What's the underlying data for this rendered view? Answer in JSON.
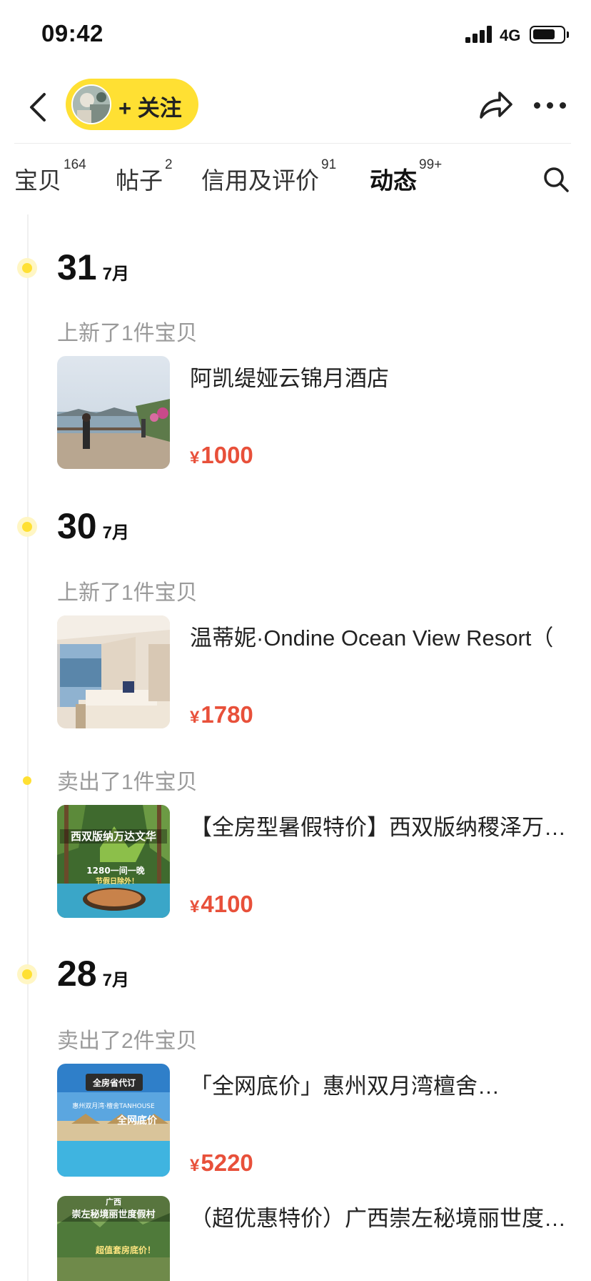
{
  "status_bar": {
    "time": "09:42",
    "network": "4G"
  },
  "header": {
    "follow_label": "+ 关注"
  },
  "tabs": [
    {
      "label": "宝贝",
      "count": "164"
    },
    {
      "label": "帖子",
      "count": "2"
    },
    {
      "label": "信用及评价",
      "count": "91"
    },
    {
      "label": "动态",
      "count": "99+"
    }
  ],
  "timeline": {
    "groups": [
      {
        "day": "31",
        "month": "7月"
      },
      {
        "day": "30",
        "month": "7月"
      },
      {
        "day": "28",
        "month": "7月"
      }
    ],
    "events": [
      {
        "label": "上新了1件宝贝"
      },
      {
        "label": "上新了1件宝贝"
      },
      {
        "label": "卖出了1件宝贝"
      },
      {
        "label": "卖出了2件宝贝"
      }
    ],
    "items": [
      {
        "title": "阿凯缇娅云锦月酒店",
        "price": "1000",
        "currency": "¥"
      },
      {
        "title": "温蒂妮·Ondine Ocean View Resort（",
        "price": "1780",
        "currency": "¥"
      },
      {
        "title": "【全房型暑假特价】西双版纳稷泽万…",
        "price": "4100",
        "currency": "¥",
        "thumb_text_1": "西双版纳万达文华",
        "thumb_text_2": "1280一间一晚",
        "thumb_text_3": "节假日除外！"
      },
      {
        "title": "「全网底价」惠州双月湾檀舍…",
        "price": "5220",
        "currency": "¥",
        "thumb_text_1": "全房省代订",
        "thumb_text_2": "惠州双月湾·檀舍TANHOUSE",
        "thumb_text_3": "全网底价"
      },
      {
        "title": "（超优惠特价）广西崇左秘境丽世度…",
        "thumb_text_1": "广西",
        "thumb_text_2": "崇左秘境丽世度假村",
        "thumb_text_3": "超值套房底价！"
      }
    ]
  },
  "colors": {
    "accent": "#ffe033",
    "price": "#e8503a",
    "muted": "#9a9a9a"
  }
}
